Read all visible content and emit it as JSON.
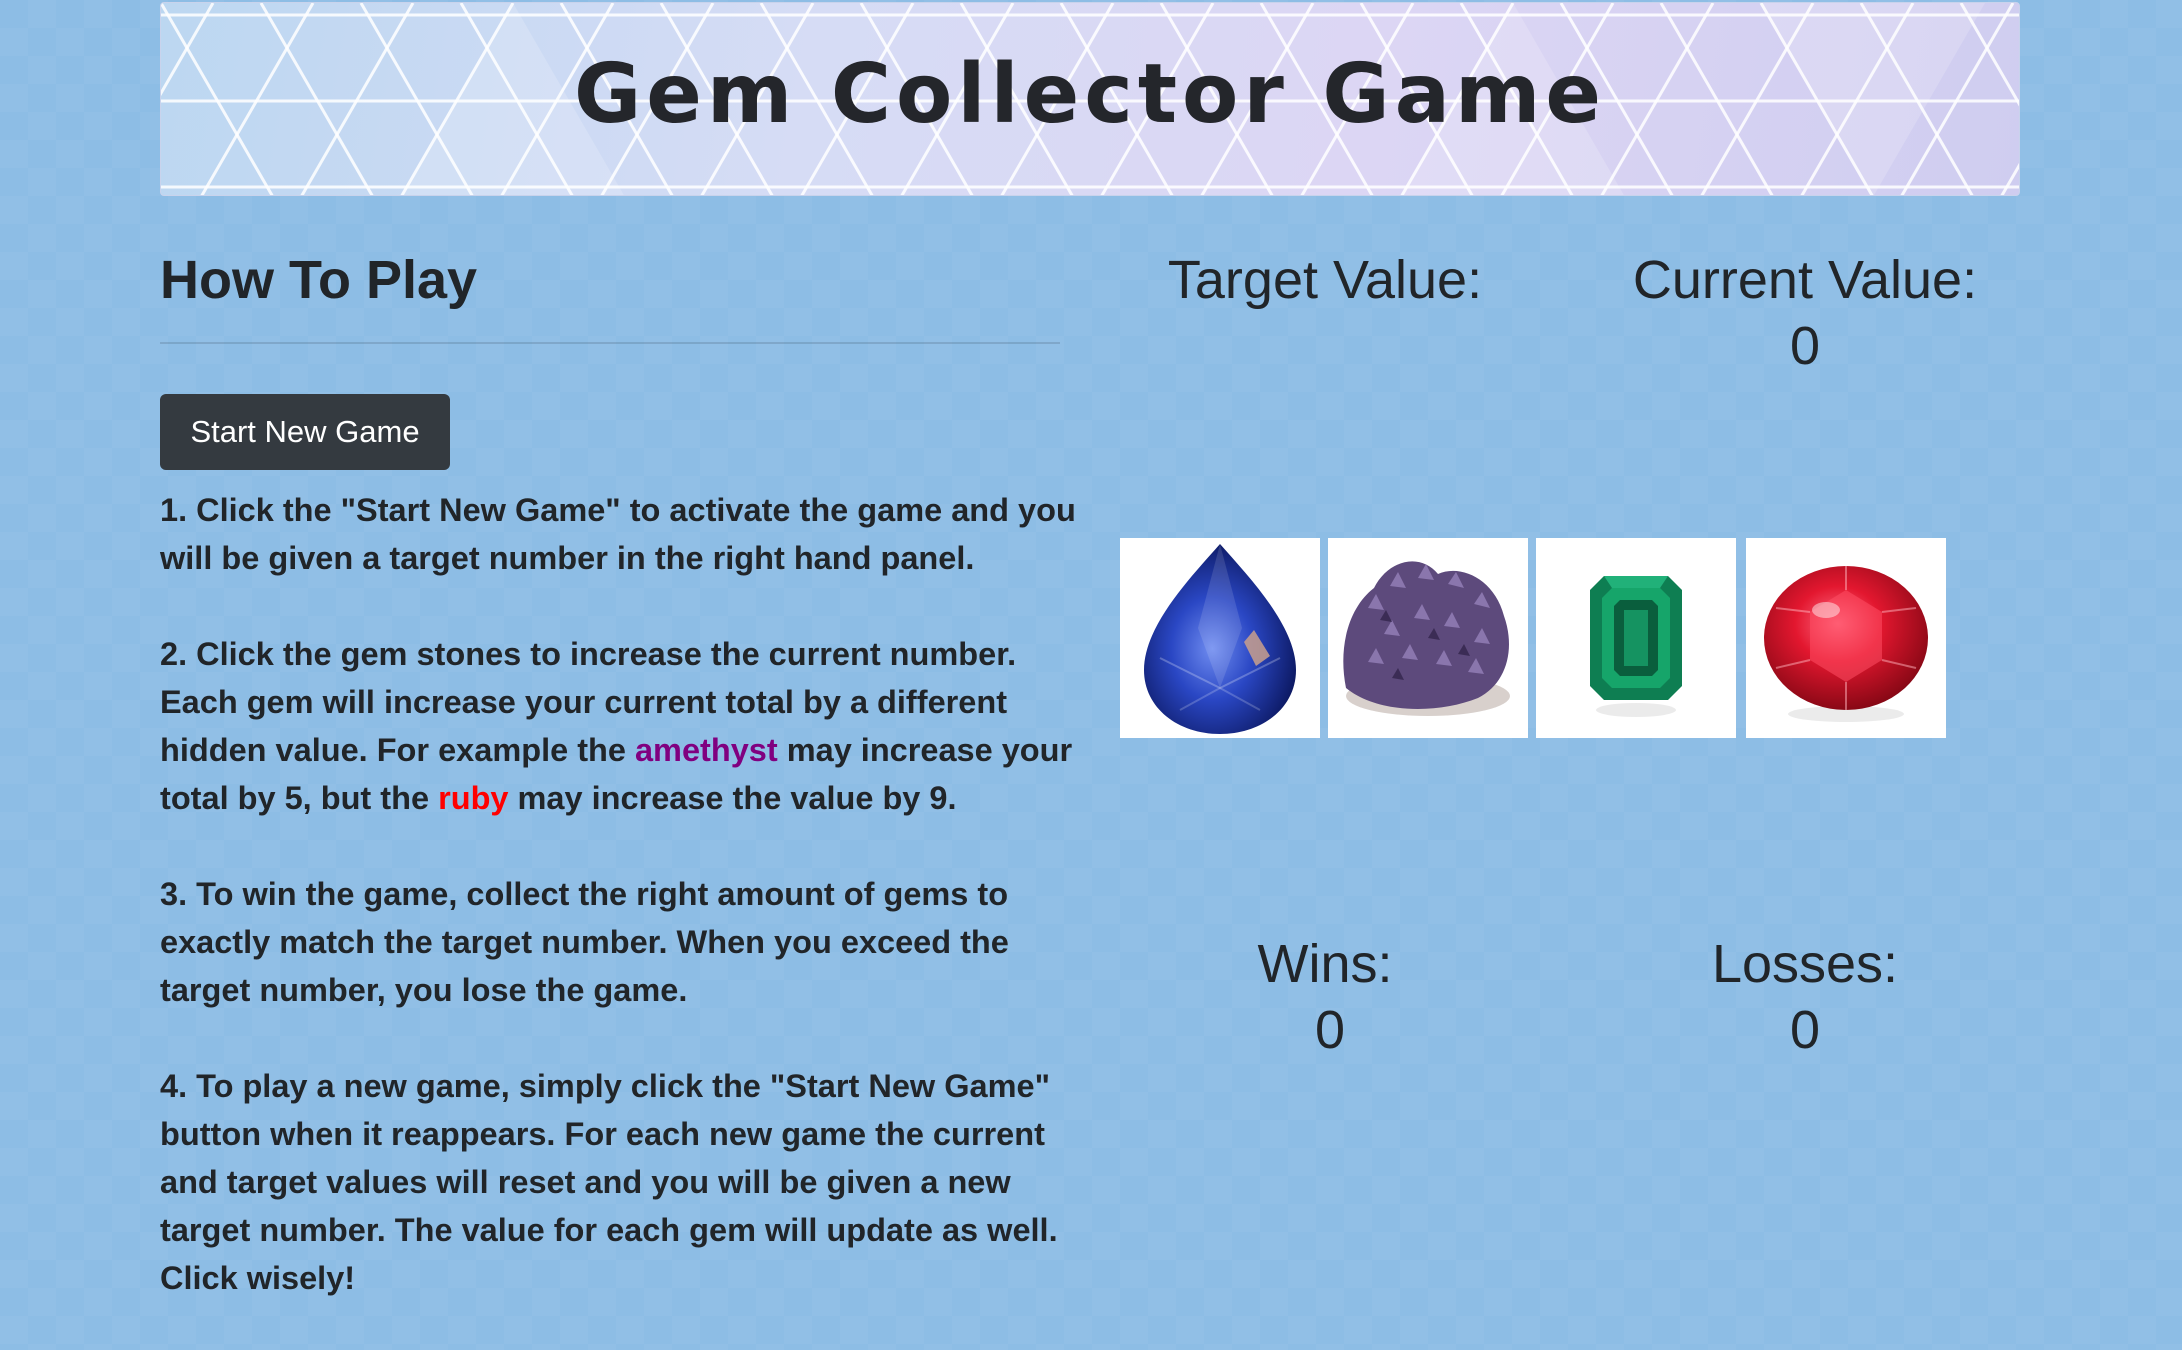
{
  "header": {
    "title": "Gem Collector Game"
  },
  "how_to_play": {
    "title": "How To Play",
    "start_button_label": "Start New Game",
    "steps": [
      {
        "text": "1. Click the \"Start New Game\" to activate the game and you will be given a target number in the right hand panel."
      },
      {
        "text_before_amethyst": "2. Click the gem stones to increase the current number. Each gem will increase your current total by a different hidden value. For example the ",
        "amethyst": "amethyst",
        "text_between": " may increase your total by 5, but the ",
        "ruby": "ruby",
        "text_after_ruby": " may increase the value by 9."
      },
      {
        "text": "3. To win the game, collect the right amount of gems to exactly match the target number. When you exceed the target number, you lose the game."
      },
      {
        "text": "4. To play a new game, simply click the \"Start New Game\" button when it reappears. For each new game the current and target values will reset and you will be given a new target number. The value for each gem will update as well. Click wisely!"
      }
    ]
  },
  "scoreboard": {
    "target_label": "Target Value:",
    "target_value": "",
    "current_label": "Current Value:",
    "current_value": "0",
    "wins_label": "Wins:",
    "wins_value": "0",
    "losses_label": "Losses:",
    "losses_value": "0"
  },
  "gems": [
    {
      "icon": "sapphire-icon",
      "color": "#1d33a8"
    },
    {
      "icon": "amethyst-icon",
      "color": "#5a4a78"
    },
    {
      "icon": "emerald-icon",
      "color": "#0f8a5a"
    },
    {
      "icon": "ruby-icon",
      "color": "#d9142a"
    }
  ],
  "colors": {
    "background": "#8dbde5",
    "button": "#343a40",
    "amethyst_text": "#800080",
    "ruby_text": "#ff0000"
  }
}
